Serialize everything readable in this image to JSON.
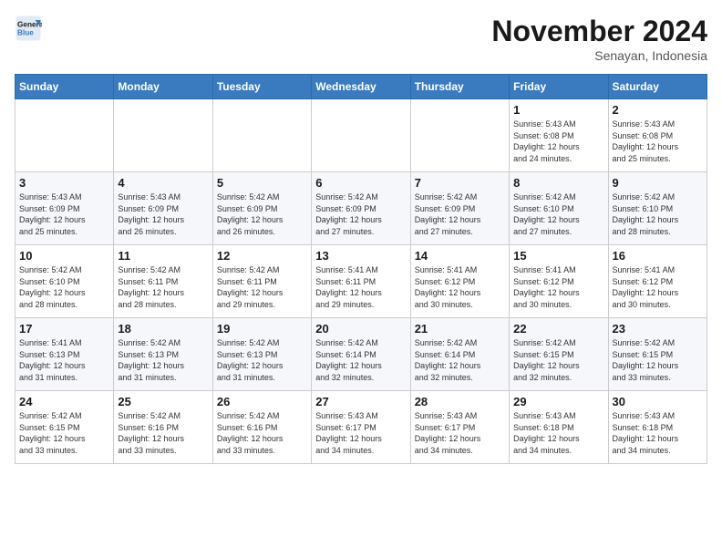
{
  "logo": {
    "line1": "General",
    "line2": "Blue"
  },
  "title": "November 2024",
  "location": "Senayan, Indonesia",
  "weekdays": [
    "Sunday",
    "Monday",
    "Tuesday",
    "Wednesday",
    "Thursday",
    "Friday",
    "Saturday"
  ],
  "weeks": [
    [
      {
        "day": "",
        "info": ""
      },
      {
        "day": "",
        "info": ""
      },
      {
        "day": "",
        "info": ""
      },
      {
        "day": "",
        "info": ""
      },
      {
        "day": "",
        "info": ""
      },
      {
        "day": "1",
        "info": "Sunrise: 5:43 AM\nSunset: 6:08 PM\nDaylight: 12 hours\nand 24 minutes."
      },
      {
        "day": "2",
        "info": "Sunrise: 5:43 AM\nSunset: 6:08 PM\nDaylight: 12 hours\nand 25 minutes."
      }
    ],
    [
      {
        "day": "3",
        "info": "Sunrise: 5:43 AM\nSunset: 6:09 PM\nDaylight: 12 hours\nand 25 minutes."
      },
      {
        "day": "4",
        "info": "Sunrise: 5:43 AM\nSunset: 6:09 PM\nDaylight: 12 hours\nand 26 minutes."
      },
      {
        "day": "5",
        "info": "Sunrise: 5:42 AM\nSunset: 6:09 PM\nDaylight: 12 hours\nand 26 minutes."
      },
      {
        "day": "6",
        "info": "Sunrise: 5:42 AM\nSunset: 6:09 PM\nDaylight: 12 hours\nand 27 minutes."
      },
      {
        "day": "7",
        "info": "Sunrise: 5:42 AM\nSunset: 6:09 PM\nDaylight: 12 hours\nand 27 minutes."
      },
      {
        "day": "8",
        "info": "Sunrise: 5:42 AM\nSunset: 6:10 PM\nDaylight: 12 hours\nand 27 minutes."
      },
      {
        "day": "9",
        "info": "Sunrise: 5:42 AM\nSunset: 6:10 PM\nDaylight: 12 hours\nand 28 minutes."
      }
    ],
    [
      {
        "day": "10",
        "info": "Sunrise: 5:42 AM\nSunset: 6:10 PM\nDaylight: 12 hours\nand 28 minutes."
      },
      {
        "day": "11",
        "info": "Sunrise: 5:42 AM\nSunset: 6:11 PM\nDaylight: 12 hours\nand 28 minutes."
      },
      {
        "day": "12",
        "info": "Sunrise: 5:42 AM\nSunset: 6:11 PM\nDaylight: 12 hours\nand 29 minutes."
      },
      {
        "day": "13",
        "info": "Sunrise: 5:41 AM\nSunset: 6:11 PM\nDaylight: 12 hours\nand 29 minutes."
      },
      {
        "day": "14",
        "info": "Sunrise: 5:41 AM\nSunset: 6:12 PM\nDaylight: 12 hours\nand 30 minutes."
      },
      {
        "day": "15",
        "info": "Sunrise: 5:41 AM\nSunset: 6:12 PM\nDaylight: 12 hours\nand 30 minutes."
      },
      {
        "day": "16",
        "info": "Sunrise: 5:41 AM\nSunset: 6:12 PM\nDaylight: 12 hours\nand 30 minutes."
      }
    ],
    [
      {
        "day": "17",
        "info": "Sunrise: 5:41 AM\nSunset: 6:13 PM\nDaylight: 12 hours\nand 31 minutes."
      },
      {
        "day": "18",
        "info": "Sunrise: 5:42 AM\nSunset: 6:13 PM\nDaylight: 12 hours\nand 31 minutes."
      },
      {
        "day": "19",
        "info": "Sunrise: 5:42 AM\nSunset: 6:13 PM\nDaylight: 12 hours\nand 31 minutes."
      },
      {
        "day": "20",
        "info": "Sunrise: 5:42 AM\nSunset: 6:14 PM\nDaylight: 12 hours\nand 32 minutes."
      },
      {
        "day": "21",
        "info": "Sunrise: 5:42 AM\nSunset: 6:14 PM\nDaylight: 12 hours\nand 32 minutes."
      },
      {
        "day": "22",
        "info": "Sunrise: 5:42 AM\nSunset: 6:15 PM\nDaylight: 12 hours\nand 32 minutes."
      },
      {
        "day": "23",
        "info": "Sunrise: 5:42 AM\nSunset: 6:15 PM\nDaylight: 12 hours\nand 33 minutes."
      }
    ],
    [
      {
        "day": "24",
        "info": "Sunrise: 5:42 AM\nSunset: 6:15 PM\nDaylight: 12 hours\nand 33 minutes."
      },
      {
        "day": "25",
        "info": "Sunrise: 5:42 AM\nSunset: 6:16 PM\nDaylight: 12 hours\nand 33 minutes."
      },
      {
        "day": "26",
        "info": "Sunrise: 5:42 AM\nSunset: 6:16 PM\nDaylight: 12 hours\nand 33 minutes."
      },
      {
        "day": "27",
        "info": "Sunrise: 5:43 AM\nSunset: 6:17 PM\nDaylight: 12 hours\nand 34 minutes."
      },
      {
        "day": "28",
        "info": "Sunrise: 5:43 AM\nSunset: 6:17 PM\nDaylight: 12 hours\nand 34 minutes."
      },
      {
        "day": "29",
        "info": "Sunrise: 5:43 AM\nSunset: 6:18 PM\nDaylight: 12 hours\nand 34 minutes."
      },
      {
        "day": "30",
        "info": "Sunrise: 5:43 AM\nSunset: 6:18 PM\nDaylight: 12 hours\nand 34 minutes."
      }
    ]
  ]
}
